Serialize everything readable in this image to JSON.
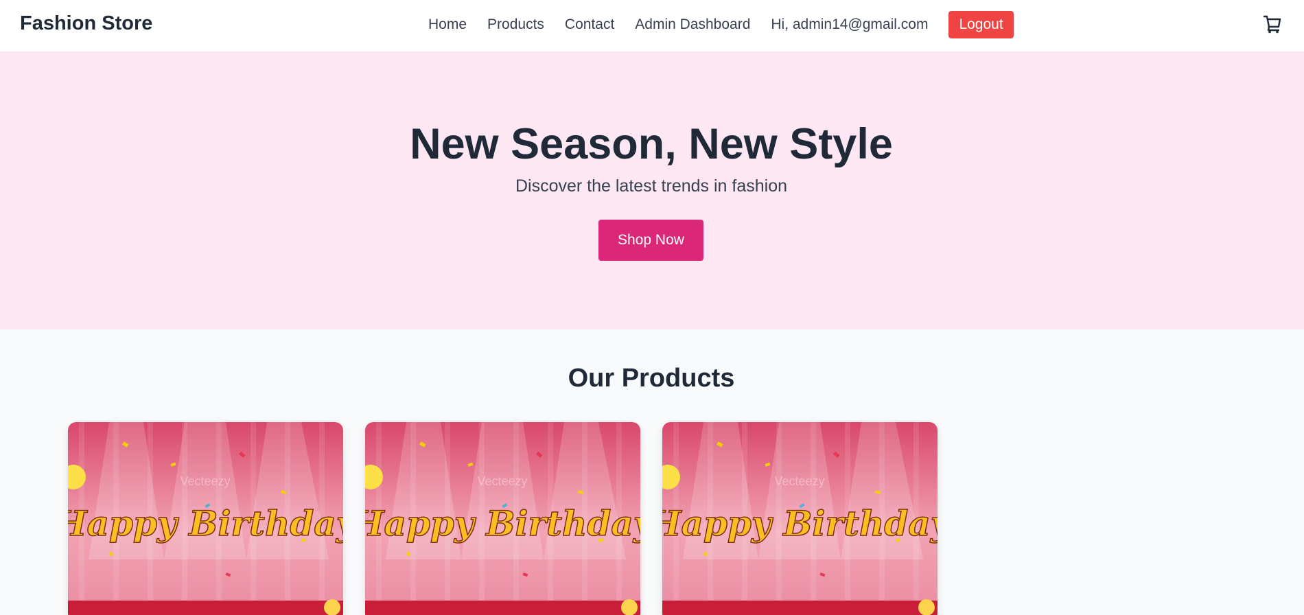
{
  "header": {
    "brand": "Fashion Store",
    "nav": [
      "Home",
      "Products",
      "Contact",
      "Admin Dashboard"
    ],
    "greeting": "Hi, admin14@gmail.com",
    "logout_label": "Logout",
    "cart_icon": "cart-icon"
  },
  "hero": {
    "title": "New Season, New Style",
    "subtitle": "Discover the latest trends in fashion",
    "cta_label": "Shop Now"
  },
  "products": {
    "title": "Our Products",
    "items": [
      {
        "image_text": "Happy Birthday",
        "watermark": "Vecteezy"
      },
      {
        "image_text": "Happy Birthday",
        "watermark": "Vecteezy"
      },
      {
        "image_text": "Happy Birthday",
        "watermark": "Vecteezy"
      }
    ]
  },
  "colors": {
    "hero_bg": "#fce7f3",
    "cta": "#db2777",
    "logout": "#ef4444",
    "text": "#1f2937"
  }
}
